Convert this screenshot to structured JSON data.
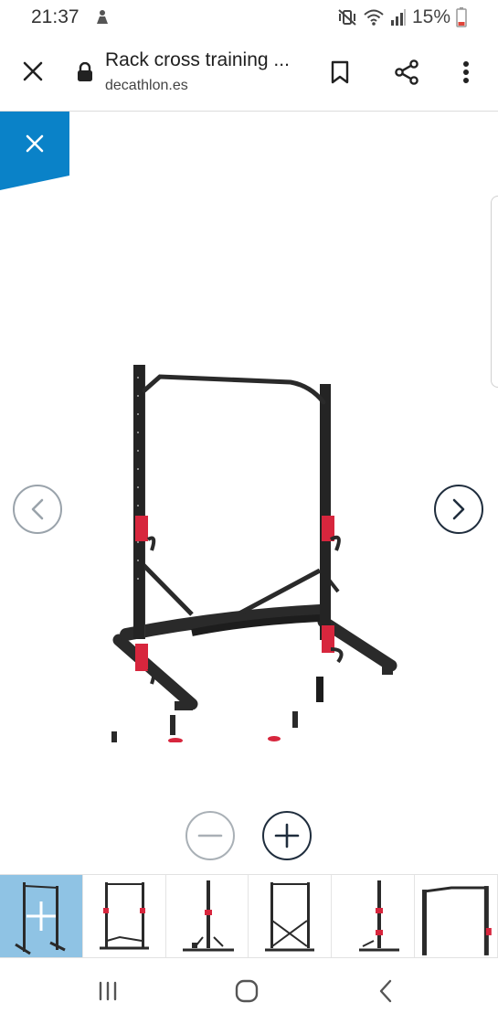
{
  "status_bar": {
    "time": "21:37",
    "battery": "15%",
    "icons": [
      "app-notification-icon",
      "mute-vibrate-icon",
      "wifi-icon",
      "signal-icon",
      "battery-icon"
    ]
  },
  "browser": {
    "title": "Rack cross training ...",
    "domain": "decathlon.es",
    "icons": [
      "close-icon",
      "lock-icon",
      "bookmark-icon",
      "share-icon",
      "more-vert-icon"
    ]
  },
  "viewer": {
    "icons": [
      "close-icon",
      "chevron-left-icon",
      "chevron-right-icon",
      "zoom-out-icon",
      "zoom-in-icon"
    ],
    "thumbnail_count": 6,
    "active_thumbnail": 1
  },
  "nav_bar": {
    "icons": [
      "recent-apps-icon",
      "home-icon",
      "back-icon"
    ]
  },
  "colors": {
    "accent_blue": "#0a82c8",
    "active_thumb": "#8fc3e4",
    "frame_black": "#2a2a2a",
    "accent_red": "#d7263d"
  }
}
